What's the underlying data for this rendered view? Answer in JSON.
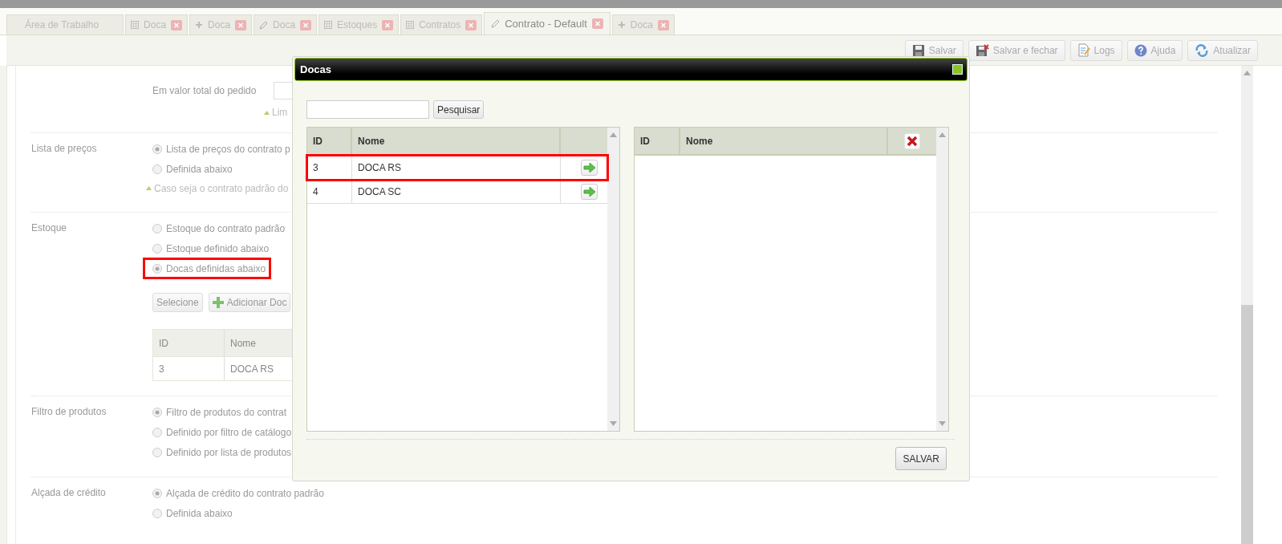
{
  "tabs": [
    {
      "label": "Área de Trabalho",
      "selected": false,
      "closable": false
    },
    {
      "label": "Doca",
      "kind": "list",
      "selected": false,
      "closable": true
    },
    {
      "label": "Doca",
      "kind": "new",
      "selected": false,
      "closable": true
    },
    {
      "label": "Doca",
      "kind": "edit",
      "selected": false,
      "closable": true
    },
    {
      "label": "Estoques",
      "kind": "list",
      "selected": false,
      "closable": true
    },
    {
      "label": "Contratos",
      "kind": "list",
      "selected": false,
      "closable": true
    },
    {
      "label": "Contrato - Default",
      "kind": "edit",
      "selected": true,
      "closable": true
    },
    {
      "label": "Doca",
      "kind": "new",
      "selected": false,
      "closable": true
    }
  ],
  "toolbar": {
    "buttons": [
      {
        "label": "Salvar",
        "kind": "save"
      },
      {
        "label": "Salvar e fechar",
        "kind": "save-close"
      },
      {
        "label": "Logs",
        "kind": "logs"
      },
      {
        "label": "Ajuda",
        "kind": "help"
      },
      {
        "label": "Atualizar",
        "kind": "refresh"
      }
    ]
  },
  "form": {
    "total_field": {
      "label": "Em valor total do pedido",
      "hint": "Lim"
    },
    "sections": [
      {
        "label": "Lista de preços",
        "options": [
          {
            "label": "Lista de preços do contrato p",
            "selected": true,
            "highlighted": false
          },
          {
            "label": "Definida abaixo",
            "selected": false,
            "highlighted": false
          }
        ],
        "hint": "Caso seja o contrato padrão do"
      },
      {
        "label": "Estoque",
        "options": [
          {
            "label": "Estoque do contrato padrão",
            "selected": false,
            "highlighted": false
          },
          {
            "label": "Estoque definido abaixo",
            "selected": false,
            "highlighted": false
          },
          {
            "label": "Docas definidas abaixo",
            "selected": true,
            "highlighted": true
          }
        ],
        "actions": [
          {
            "label": "Selecione",
            "kind": "plain"
          },
          {
            "label": "Adicionar Doc",
            "kind": "add"
          }
        ],
        "table": {
          "columns": [
            "ID",
            "Nome"
          ],
          "rows": [
            [
              "3",
              "DOCA RS"
            ]
          ]
        }
      },
      {
        "label": "Filtro de produtos",
        "options": [
          {
            "label": "Filtro de produtos do contrat",
            "selected": true,
            "highlighted": false
          },
          {
            "label": "Definido por filtro de catálogo",
            "selected": false,
            "highlighted": false
          },
          {
            "label": "Definido por lista de produtos",
            "selected": false,
            "highlighted": false
          }
        ]
      },
      {
        "label": "Alçada de crédito",
        "options": [
          {
            "label": "Alçada de crédito do contrato padrão",
            "selected": true,
            "highlighted": false
          },
          {
            "label": "Definida abaixo",
            "selected": false,
            "highlighted": false
          }
        ]
      }
    ]
  },
  "dialog": {
    "title": "Docas",
    "search_button": "Pesquisar",
    "available": {
      "columns": [
        "ID",
        "Nome"
      ],
      "rows": [
        {
          "id": "3",
          "name": "DOCA RS",
          "highlighted": true
        },
        {
          "id": "4",
          "name": "DOCA SC",
          "highlighted": false
        }
      ]
    },
    "chosen": {
      "columns": [
        "ID",
        "Nome"
      ]
    },
    "save_button": "SALVAR"
  }
}
